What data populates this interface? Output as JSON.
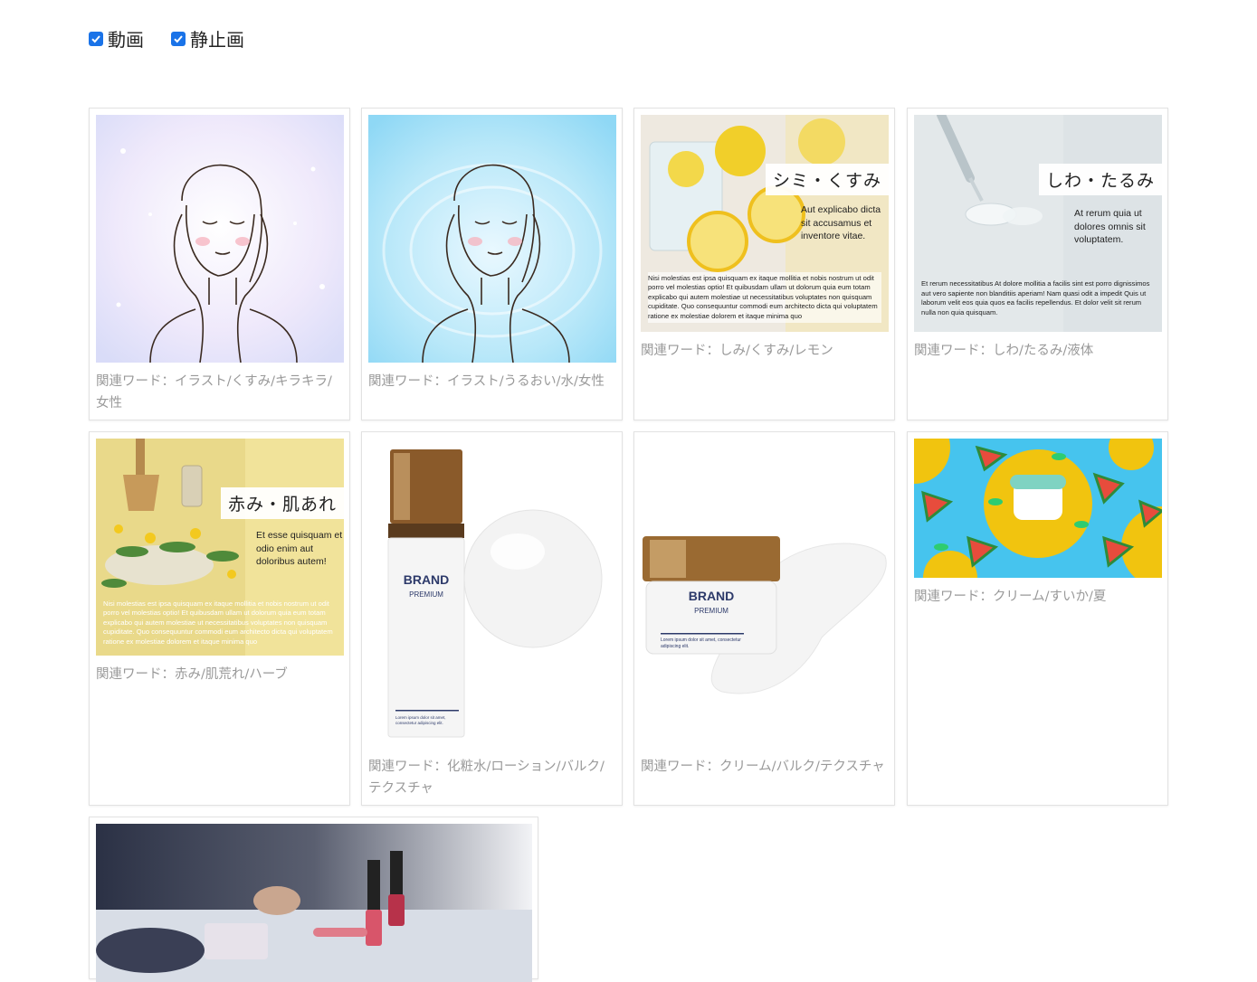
{
  "filters": [
    {
      "label": "動画",
      "checked": true
    },
    {
      "label": "静止画",
      "checked": true
    }
  ],
  "cards": [
    {
      "caption": "関連ワード：イラスト/くすみ/キラキラ/女性"
    },
    {
      "caption": "関連ワード：イラスト/うるおい/水/女性"
    },
    {
      "caption": "関連ワード：しみ/くすみ/レモン",
      "overlay_title": "シミ・くすみ",
      "overlay_sub": "Aut explicabo dicta sit accusamus et inventore vitae.",
      "overlay_body": "Nisi molestias est ipsa quisquam ex itaque mollitia et nobis nostrum ut odit porro vel molestias optio! Et quibusdam ullam ut dolorum quia eum totam explicabo qui autem molestiae ut necessitatibus voluptates non quisquam cupiditate. Quo consequuntur commodi eum architecto dicta qui voluptatem ratione ex molestiae dolorem et itaque minima quo"
    },
    {
      "caption": "関連ワード：しわ/たるみ/液体",
      "overlay_title": "しわ・たるみ",
      "overlay_sub": "At rerum quia ut dolores omnis sit voluptatem.",
      "overlay_body": "Et rerum necessitatibus At dolore mollitia a facilis sint est porro dignissimos aut vero sapiente non blanditiis aperiam! Nam quasi odit a impedit Quis ut laborum velit eos quia quos ea facilis repellendus. Et dolor velit sit rerum nulla non quia quisquam."
    },
    {
      "caption": "関連ワード：赤み/肌荒れ/ハーブ",
      "overlay_title": "赤み・肌あれ",
      "overlay_sub": "Et esse quisquam et odio enim aut doloribus autem!",
      "overlay_body": "Nisi molestias est ipsa quisquam ex itaque mollitia et nobis nostrum ut odit porro vel molestias optio! Et quibusdam ullam ut dolorum quia eum totam explicabo qui autem molestiae ut necessitatibus voluptates non quisquam cupiditate. Quo consequuntur commodi eum architecto dicta qui voluptatem ratione ex molestiae dolorem et itaque minima quo"
    },
    {
      "caption": "関連ワード：化粧水/ローション/バルク/テクスチャ",
      "product_brand": "BRAND",
      "product_line": "PREMIUM",
      "product_small": "Lorem ipsum dolor sit amet, consectetur adipiscing elit."
    },
    {
      "caption": "関連ワード：クリーム/バルク/テクスチャ",
      "product_brand": "BRAND",
      "product_line": "PREMIUM",
      "product_small": "Lorem ipsum dolor sit amet, consectetur adipiscing elit."
    },
    {
      "caption": "関連ワード：クリーム/すいか/夏"
    },
    {
      "caption": ""
    }
  ],
  "icons": {
    "checkbox": "check-icon"
  },
  "colors": {
    "accent": "#1a73e8",
    "caption": "#999999",
    "border": "#e2e2e2"
  }
}
